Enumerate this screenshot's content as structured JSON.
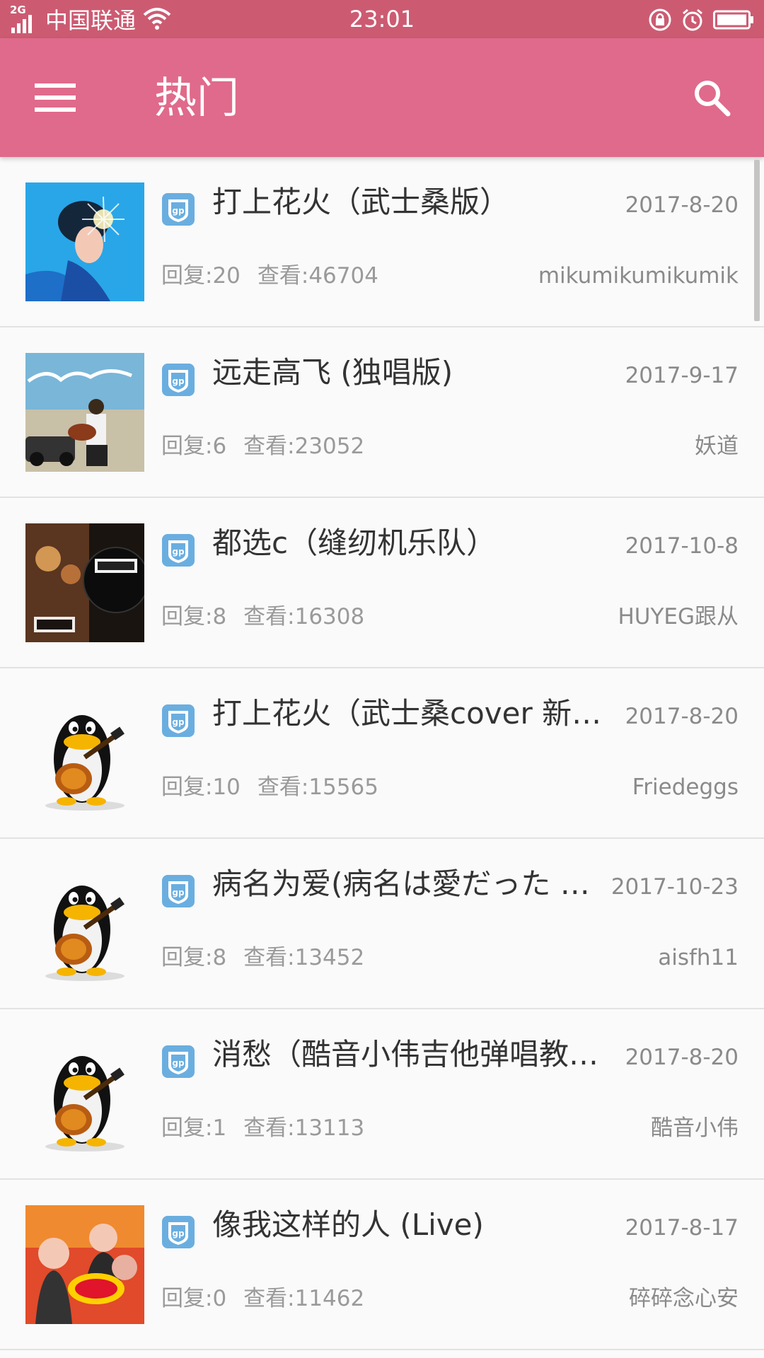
{
  "status_bar": {
    "network": "2G",
    "carrier": "中国联通",
    "time": "23:01",
    "bg_color": "#cc5b72"
  },
  "app_bar": {
    "title": "热门",
    "menu_icon": "hamburger-menu-icon",
    "search_icon": "search-icon",
    "bg_color": "#e06a8b"
  },
  "items": [
    {
      "title": "打上花火（武士桑版）",
      "date": "2017-8-20",
      "replies": "回复:20",
      "views": "查看:46704",
      "author": "mikumikumikumik",
      "thumb": "album-art-blue"
    },
    {
      "title": "远走高飞 (独唱版)",
      "date": "2017-9-17",
      "replies": "回复:6",
      "views": "查看:23052",
      "author": "妖道",
      "thumb": "album-art-guitarist"
    },
    {
      "title": "都选c（缝纫机乐队）",
      "date": "2017-10-8",
      "replies": "回复:8",
      "views": "查看:16308",
      "author": "HUYEG跟从",
      "thumb": "album-art-band"
    },
    {
      "title": "打上花火（武士桑cover 新…",
      "date": "2017-8-20",
      "replies": "回复:10",
      "views": "查看:15565",
      "author": "Friedeggs",
      "thumb": "penguin-guitar-avatar"
    },
    {
      "title": "病名为爱(病名は愛だった …",
      "date": "2017-10-23",
      "replies": "回复:8",
      "views": "查看:13452",
      "author": "aisfh11",
      "thumb": "penguin-guitar-avatar"
    },
    {
      "title": "消愁（酷音小伟吉他弹唱教…",
      "date": "2017-8-20",
      "replies": "回复:1",
      "views": "查看:13113",
      "author": "酷音小伟",
      "thumb": "penguin-guitar-avatar"
    },
    {
      "title": "像我这样的人 (Live)",
      "date": "2017-8-17",
      "replies": "回复:0",
      "views": "查看:11462",
      "author": "碎碎念心安",
      "thumb": "album-art-live-show"
    }
  ]
}
